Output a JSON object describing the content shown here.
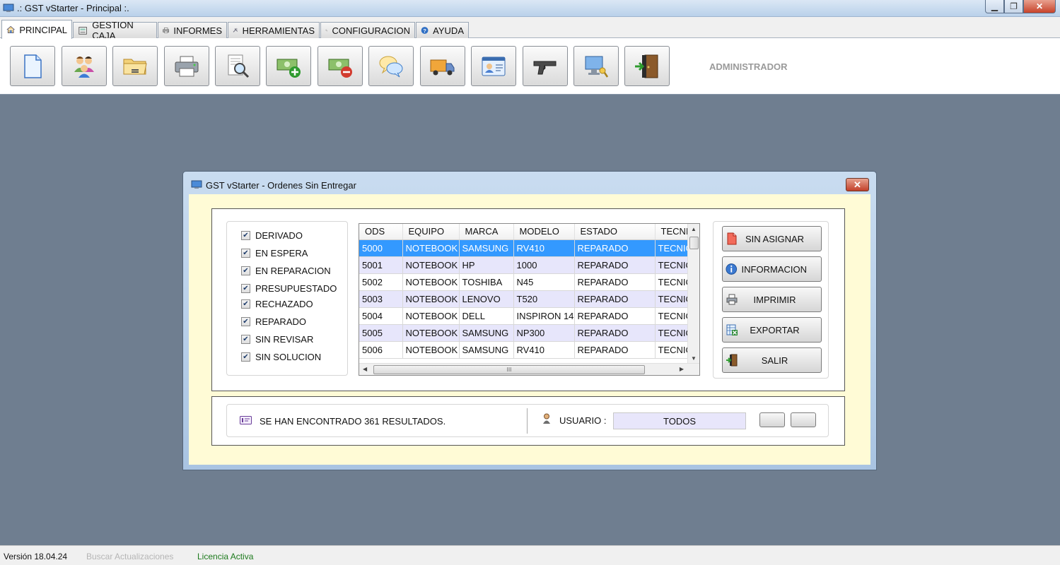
{
  "window": {
    "title": ".: GST vStarter - Principal :."
  },
  "tabs": [
    {
      "label": "PRINCIPAL",
      "icon": "home-icon"
    },
    {
      "label": "GESTION CAJA",
      "icon": "cash-register-icon"
    },
    {
      "label": "INFORMES",
      "icon": "printer-icon"
    },
    {
      "label": "HERRAMIENTAS",
      "icon": "tools-icon"
    },
    {
      "label": "CONFIGURACION",
      "icon": "settings-icon"
    },
    {
      "label": "AYUDA",
      "icon": "help-icon"
    }
  ],
  "toolbar": {
    "buttons": [
      {
        "icon": "new-document-icon"
      },
      {
        "icon": "clients-icon"
      },
      {
        "icon": "open-folder-icon"
      },
      {
        "icon": "print-icon"
      },
      {
        "icon": "search-document-icon"
      },
      {
        "icon": "cash-add-icon"
      },
      {
        "icon": "cash-remove-icon"
      },
      {
        "icon": "chat-icon"
      },
      {
        "icon": "delivery-truck-icon"
      },
      {
        "icon": "id-card-icon"
      },
      {
        "icon": "gun-icon"
      },
      {
        "icon": "remote-support-icon"
      },
      {
        "icon": "exit-door-icon"
      }
    ],
    "user_role": "ADMINISTRADOR"
  },
  "dialog": {
    "title": "GST vStarter - Ordenes Sin Entregar",
    "filters": [
      {
        "label": "DERIVADO",
        "checked": true
      },
      {
        "label": "EN ESPERA",
        "checked": true
      },
      {
        "label": "EN REPARACION",
        "checked": true
      },
      {
        "label": "PRESUPUESTADO",
        "checked": true
      },
      {
        "label": "RECHAZADO",
        "checked": true
      },
      {
        "label": "REPARADO",
        "checked": true
      },
      {
        "label": "SIN REVISAR",
        "checked": true
      },
      {
        "label": "SIN SOLUCION",
        "checked": true
      }
    ],
    "grid": {
      "columns": [
        "ODS",
        "EQUIPO",
        "MARCA",
        "MODELO",
        "ESTADO",
        "TECNI"
      ],
      "rows": [
        [
          "5000",
          "NOTEBOOK",
          "SAMSUNG",
          "RV410",
          "REPARADO",
          "TECNIC"
        ],
        [
          "5001",
          "NOTEBOOK",
          "HP",
          "1000",
          "REPARADO",
          "TECNIC"
        ],
        [
          "5002",
          "NOTEBOOK",
          "TOSHIBA",
          "N45",
          "REPARADO",
          "TECNIC"
        ],
        [
          "5003",
          "NOTEBOOK",
          "LENOVO",
          "T520",
          "REPARADO",
          "TECNIC"
        ],
        [
          "5004",
          "NOTEBOOK",
          "DELL",
          "INSPIRON 14",
          "REPARADO",
          "TECNIC"
        ],
        [
          "5005",
          "NOTEBOOK",
          "SAMSUNG",
          "NP300",
          "REPARADO",
          "TECNIC"
        ],
        [
          "5006",
          "NOTEBOOK",
          "SAMSUNG",
          "RV410",
          "REPARADO",
          "TECNIC"
        ]
      ],
      "selected_row": 0,
      "hscroll_grip": "III"
    },
    "actions": [
      {
        "label": "SIN ASIGNAR",
        "icon": "unassigned-document-icon"
      },
      {
        "label": "INFORMACION",
        "icon": "info-icon"
      },
      {
        "label": "IMPRIMIR",
        "icon": "printer-icon"
      },
      {
        "label": "EXPORTAR",
        "icon": "export-excel-icon"
      },
      {
        "label": "SALIR",
        "icon": "exit-door-icon"
      }
    ],
    "status": {
      "results_text": "SE HAN ENCONTRADO 361 RESULTADOS.",
      "user_label": "USUARIO :",
      "user_value": "TODOS"
    }
  },
  "statusbar": {
    "version": "Versión 18.04.24",
    "updates": "Buscar Actualizaciones",
    "license": "Licencia Activa"
  },
  "colors": {
    "desktop": "#6f7e90",
    "dialog_body": "#fffbd6",
    "selected_row": "#3399ff",
    "alt_row": "#e7e6fb",
    "license_green": "#1c7a1c"
  }
}
